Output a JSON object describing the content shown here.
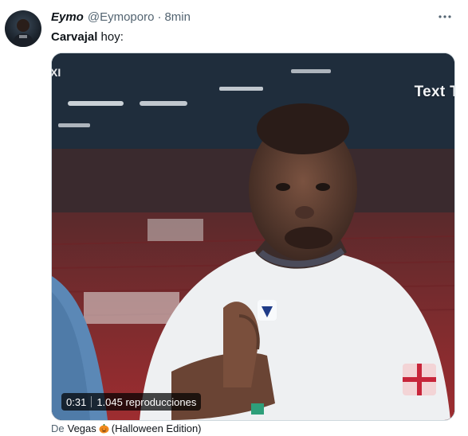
{
  "tweet": {
    "display_name": "Eymo",
    "handle": "@Eymoporo",
    "separator": "·",
    "time": "8min",
    "text_bold": "Carvajal",
    "text_rest": " hoy:",
    "more_icon": "more-horizontal-icon"
  },
  "media": {
    "overlay_text": "Text T",
    "overlay_left": "XI",
    "duration": "0:31",
    "views": "1.045 reproducciones"
  },
  "source": {
    "prefix": "De",
    "name": "Vegas",
    "emoji_icon": "pumpkin-icon",
    "edition": "(Halloween Edition)"
  },
  "colors": {
    "secondary_text": "#536471",
    "primary_text": "#0f1419",
    "media_border": "#cfd9de"
  }
}
